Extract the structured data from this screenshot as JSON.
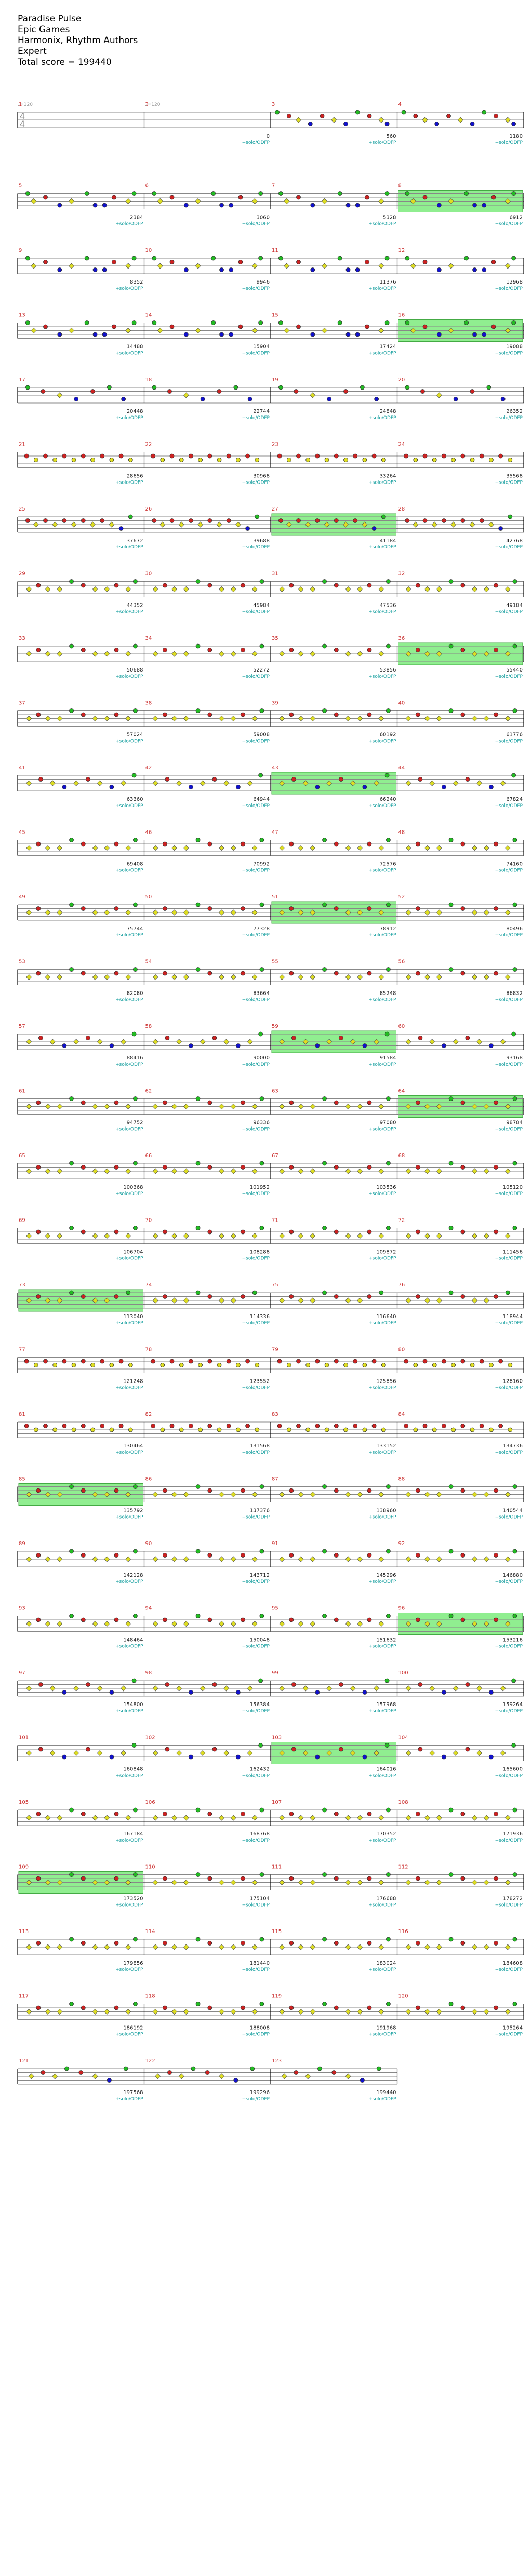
{
  "song": {
    "title": "Paradise Pulse",
    "artist": "Epic Games",
    "charter": "Harmonix, Rhythm Authors",
    "difficulty": "Expert",
    "total_score_label": "Total score = 199440"
  },
  "time_signature": "4/4",
  "tempo_markers": [
    "♩=120",
    "♩=120"
  ],
  "annotation_label": "+solo/ODFP",
  "lane_colors": {
    "green": "#22bb22",
    "red": "#cc2222",
    "yellow": "#dddd22",
    "blue": "#1111cc",
    "orange": "#ee8800"
  },
  "overdrive_color": "#90ee90",
  "rows": [
    {
      "measures": [
        1,
        2,
        3,
        4
      ],
      "scores": [
        "",
        "0",
        "560",
        "1180"
      ],
      "pattern": 0,
      "od": []
    },
    {
      "measures": [
        5,
        6,
        7,
        8
      ],
      "scores": [
        "2384",
        "3060",
        "5328",
        "6912"
      ],
      "pattern": 1,
      "od": [
        3
      ]
    },
    {
      "measures": [
        9,
        10,
        11,
        12
      ],
      "scores": [
        "8352",
        "9946",
        "11376",
        "12968"
      ],
      "pattern": 1,
      "od": []
    },
    {
      "measures": [
        13,
        14,
        15,
        16
      ],
      "scores": [
        "14488",
        "15904",
        "17424",
        "19088"
      ],
      "pattern": 1,
      "od": [
        3
      ]
    },
    {
      "measures": [
        17,
        18,
        19,
        20
      ],
      "scores": [
        "20448",
        "22744",
        "24848",
        "26352"
      ],
      "pattern": 2,
      "od": []
    },
    {
      "measures": [
        21,
        22,
        23,
        24
      ],
      "scores": [
        "28656",
        "30968",
        "33264",
        "35568"
      ],
      "pattern": 3,
      "od": []
    },
    {
      "measures": [
        25,
        26,
        27,
        28
      ],
      "scores": [
        "37672",
        "39688",
        "41184",
        "42768"
      ],
      "pattern": 4,
      "od": [
        2
      ]
    },
    {
      "measures": [
        29,
        30,
        31,
        32
      ],
      "scores": [
        "44352",
        "45984",
        "47536",
        "49184"
      ],
      "pattern": 5,
      "od": []
    },
    {
      "measures": [
        33,
        34,
        35,
        36
      ],
      "scores": [
        "50688",
        "52272",
        "53856",
        "55440"
      ],
      "pattern": 5,
      "od": [
        3
      ]
    },
    {
      "measures": [
        37,
        38,
        39,
        40
      ],
      "scores": [
        "57024",
        "59008",
        "60192",
        "61776"
      ],
      "pattern": 5,
      "od": []
    },
    {
      "measures": [
        41,
        42,
        43,
        44
      ],
      "scores": [
        "63360",
        "64944",
        "66240",
        "67824"
      ],
      "pattern": 6,
      "od": [
        2
      ]
    },
    {
      "measures": [
        45,
        46,
        47,
        48
      ],
      "scores": [
        "69408",
        "70992",
        "72576",
        "74160"
      ],
      "pattern": 5,
      "od": []
    },
    {
      "measures": [
        49,
        50,
        51,
        52
      ],
      "scores": [
        "75744",
        "77328",
        "78912",
        "80496"
      ],
      "pattern": 5,
      "od": [
        2
      ]
    },
    {
      "measures": [
        53,
        54,
        55,
        56
      ],
      "scores": [
        "82080",
        "83664",
        "85248",
        "86832"
      ],
      "pattern": 5,
      "od": []
    },
    {
      "measures": [
        57,
        58,
        59,
        60
      ],
      "scores": [
        "88416",
        "90000",
        "91584",
        "93168"
      ],
      "pattern": 6,
      "od": [
        2
      ]
    },
    {
      "measures": [
        61,
        62,
        63,
        64
      ],
      "scores": [
        "94752",
        "96336",
        "97080",
        "98784"
      ],
      "pattern": 5,
      "od": [
        3
      ]
    },
    {
      "measures": [
        65,
        66,
        67,
        68
      ],
      "scores": [
        "100368",
        "101952",
        "103536",
        "105120"
      ],
      "pattern": 5,
      "od": []
    },
    {
      "measures": [
        69,
        70,
        71,
        72
      ],
      "scores": [
        "106704",
        "108288",
        "109872",
        "111456"
      ],
      "pattern": 5,
      "od": []
    },
    {
      "measures": [
        73,
        74,
        75,
        76
      ],
      "scores": [
        "113040",
        "114336",
        "116640",
        "118944"
      ],
      "pattern": 7,
      "od": [
        0
      ]
    },
    {
      "measures": [
        77,
        78,
        79,
        80
      ],
      "scores": [
        "121248",
        "123552",
        "125856",
        "128160"
      ],
      "pattern": 3,
      "od": []
    },
    {
      "measures": [
        81,
        82,
        83,
        84
      ],
      "scores": [
        "130464",
        "131568",
        "133152",
        "134736"
      ],
      "pattern": 8,
      "od": []
    },
    {
      "measures": [
        85,
        86,
        87,
        88
      ],
      "scores": [
        "135792",
        "137376",
        "138960",
        "140544"
      ],
      "pattern": 5,
      "od": [
        0
      ]
    },
    {
      "measures": [
        89,
        90,
        91,
        92
      ],
      "scores": [
        "142128",
        "143712",
        "145296",
        "146880"
      ],
      "pattern": 5,
      "od": []
    },
    {
      "measures": [
        93,
        94,
        95,
        96
      ],
      "scores": [
        "148464",
        "150048",
        "151632",
        "153216"
      ],
      "pattern": 5,
      "od": [
        3
      ]
    },
    {
      "measures": [
        97,
        98,
        99,
        100
      ],
      "scores": [
        "154800",
        "156384",
        "157968",
        "159264"
      ],
      "pattern": 6,
      "od": []
    },
    {
      "measures": [
        101,
        102,
        103,
        104
      ],
      "scores": [
        "160848",
        "162432",
        "164016",
        "165600"
      ],
      "pattern": 6,
      "od": [
        2
      ]
    },
    {
      "measures": [
        105,
        106,
        107,
        108
      ],
      "scores": [
        "167184",
        "168768",
        "170352",
        "171936"
      ],
      "pattern": 5,
      "od": []
    },
    {
      "measures": [
        109,
        110,
        111,
        112
      ],
      "scores": [
        "173520",
        "175104",
        "176688",
        "178272"
      ],
      "pattern": 5,
      "od": [
        0
      ]
    },
    {
      "measures": [
        113,
        114,
        115,
        116
      ],
      "scores": [
        "179856",
        "181440",
        "183024",
        "184608"
      ],
      "pattern": 5,
      "od": []
    },
    {
      "measures": [
        117,
        118,
        119,
        120
      ],
      "scores": [
        "186192",
        "188008",
        "191968",
        "195264"
      ],
      "pattern": 5,
      "od": []
    },
    {
      "measures": [
        121,
        122,
        123
      ],
      "scores": [
        "197568",
        "199296",
        "199440"
      ],
      "pattern": 9,
      "od": []
    }
  ]
}
